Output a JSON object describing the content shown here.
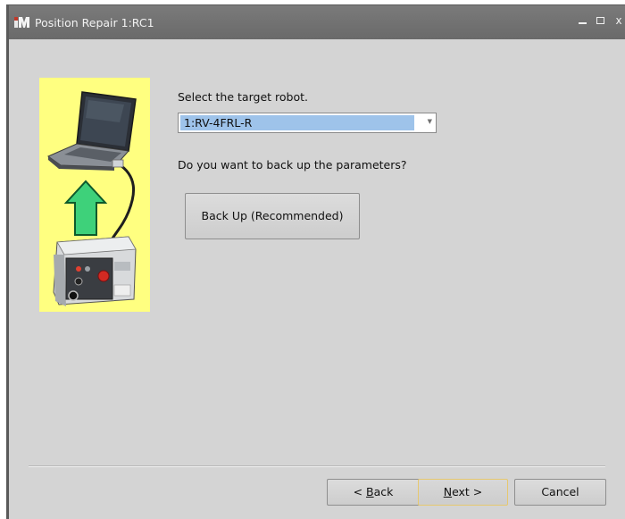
{
  "window": {
    "title": "Position Repair 1:RC1",
    "controls": {
      "minimize_icon": "minimize-icon",
      "maximize_icon": "maximize-icon",
      "close_glyph": "x"
    }
  },
  "main": {
    "select_robot_label": "Select the target robot.",
    "robot_select": {
      "value": "1:RV-4FRL-R",
      "arrow_glyph": "▼"
    },
    "backup_question": "Do you want to back up the parameters?",
    "backup_button_label": "Back Up (Recommended)"
  },
  "footer": {
    "back_prefix": "< ",
    "back_underlined": "B",
    "back_rest": "ack",
    "next_underlined": "N",
    "next_rest": "ext >",
    "cancel_label": "Cancel"
  },
  "colors": {
    "side_panel": "#ffff80",
    "selection": "#9ec3ea",
    "titlebar": "#6e6e6e"
  }
}
